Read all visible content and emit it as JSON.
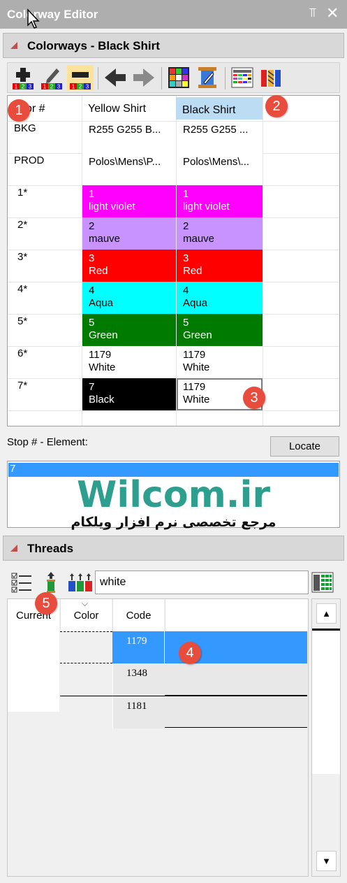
{
  "window": {
    "title": "Colorway Editor",
    "pin_glyph": "⫪",
    "close_glyph": "✕"
  },
  "colorways_section": {
    "title": "Colorways - Black Shirt"
  },
  "colorway_toolbar": {
    "number_labels": [
      "1",
      "2",
      "3"
    ],
    "icons": [
      "add-colorway-icon",
      "edit-colorway-icon",
      "remove-colorway-icon",
      "move-left-icon",
      "move-right-icon",
      "palette-grid-icon",
      "edit-thread-icon",
      "thread-chart-icon",
      "thread-spools-icon"
    ]
  },
  "colorway_grid": {
    "headers": [
      "Color #",
      "Yellow Shirt",
      "Black Shirt"
    ],
    "header_visible": [
      "or #",
      "Yellow Shirt",
      "Black Shirt"
    ],
    "rows": [
      {
        "label": "BKG",
        "a": {
          "line1": "R255 G255 B...",
          "line2": "",
          "bg": "#ffffff",
          "fg": "#000000"
        },
        "b": {
          "line1": "R255 G255 ...",
          "line2": "",
          "bg": "#ffffff",
          "fg": "#000000"
        }
      },
      {
        "label": "PROD",
        "a": {
          "line1": "Polos\\Mens\\P...",
          "line2": "",
          "bg": "#ffffff",
          "fg": "#000000"
        },
        "b": {
          "line1": "Polos\\Mens\\...",
          "line2": "",
          "bg": "#ffffff",
          "fg": "#000000"
        }
      },
      {
        "label": "1*",
        "a": {
          "line1": "1",
          "line2": "light violet",
          "bg": "#ff00ff",
          "fg": "#ffffff"
        },
        "b": {
          "line1": "1",
          "line2": "light violet",
          "bg": "#ff00ff",
          "fg": "#ffffff"
        }
      },
      {
        "label": "2*",
        "a": {
          "line1": "2",
          "line2": "mauve",
          "bg": "#c993ff",
          "fg": "#000000"
        },
        "b": {
          "line1": "2",
          "line2": "mauve",
          "bg": "#c993ff",
          "fg": "#000000"
        }
      },
      {
        "label": "3*",
        "a": {
          "line1": "3",
          "line2": "Red",
          "bg": "#ff0000",
          "fg": "#ffffff"
        },
        "b": {
          "line1": "3",
          "line2": "Red",
          "bg": "#ff0000",
          "fg": "#ffffff"
        }
      },
      {
        "label": "4*",
        "a": {
          "line1": "4",
          "line2": "Aqua",
          "bg": "#00ffff",
          "fg": "#000000"
        },
        "b": {
          "line1": "4",
          "line2": "Aqua",
          "bg": "#00ffff",
          "fg": "#000000"
        }
      },
      {
        "label": "5*",
        "a": {
          "line1": "5",
          "line2": "Green",
          "bg": "#007b00",
          "fg": "#ffffff"
        },
        "b": {
          "line1": "5",
          "line2": "Green",
          "bg": "#007b00",
          "fg": "#ffffff"
        }
      },
      {
        "label": "6*",
        "a": {
          "line1": "1179",
          "line2": "White",
          "bg": "#ffffff",
          "fg": "#000000"
        },
        "b": {
          "line1": "1179",
          "line2": "White",
          "bg": "#ffffff",
          "fg": "#000000"
        }
      },
      {
        "label": "7*",
        "a": {
          "line1": "7",
          "line2": "Black",
          "bg": "#000000",
          "fg": "#ffffff"
        },
        "b": {
          "line1": "1179",
          "line2": "White",
          "bg": "#ffffff",
          "fg": "#000000"
        }
      }
    ],
    "selected_header_bg": "#bcdcf4"
  },
  "callouts": [
    "1",
    "2",
    "3",
    "4",
    "5"
  ],
  "stop_element": {
    "label": "Stop # - Element:",
    "locate_label": "Locate",
    "selected_value": "7"
  },
  "watermark": {
    "title": "Wilcom.ir",
    "subtitle": "مرجع تخصصی نرم افزار ویلکام"
  },
  "threads_section": {
    "title": "Threads"
  },
  "threads_toolbar": {
    "search_value": "white",
    "icons": [
      "checklist-icon",
      "single-spool-icon",
      "multi-spool-icon",
      "thread-chart-icon"
    ]
  },
  "threads_table": {
    "headers": [
      "Current",
      "Color",
      "Code"
    ],
    "sort_glyph": "⌵",
    "rows": [
      {
        "code": "1179",
        "selected": true
      },
      {
        "code": "1348",
        "selected": false
      },
      {
        "code": "1181",
        "selected": false
      }
    ]
  },
  "scrollbar": {
    "up_glyph": "▲",
    "down_glyph": "▼"
  },
  "colors": {
    "accent": "#3399ff",
    "badge": "#e74c3c",
    "section_triangle": "#c0504d",
    "watermark": "#2e9e8f"
  }
}
